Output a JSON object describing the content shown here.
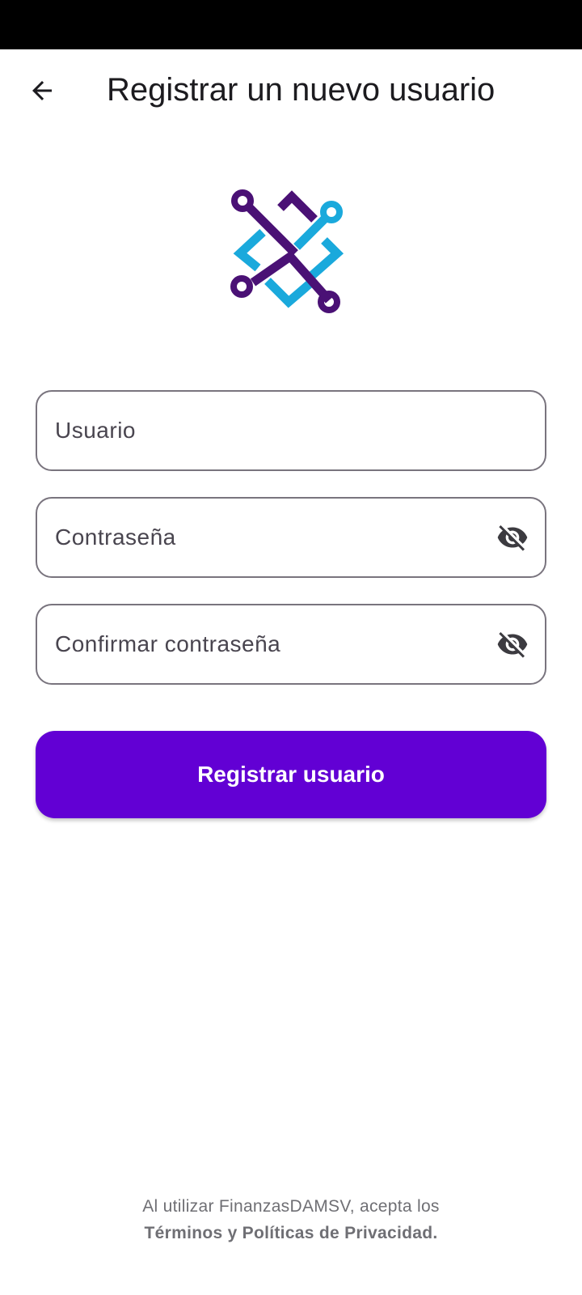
{
  "app_bar": {
    "title": "Registrar un nuevo usuario",
    "back_icon": "arrow-back-icon"
  },
  "logo": {
    "icon": "finanzas-logo-icon",
    "colors": {
      "purple": "#4a1175",
      "cyan": "#1aa9dc"
    }
  },
  "form": {
    "username": {
      "placeholder": "Usuario",
      "value": ""
    },
    "password": {
      "placeholder": "Contraseña",
      "value": "",
      "toggle_icon": "visibility-off-icon"
    },
    "confirm_password": {
      "placeholder": "Confirmar contraseña",
      "value": "",
      "toggle_icon": "visibility-off-icon"
    }
  },
  "submit_button": {
    "label": "Registrar usuario",
    "color": "#6200d4"
  },
  "footer": {
    "text": "Al utilizar FinanzasDAMSV, acepta los",
    "link": "Términos y Políticas de Privacidad."
  }
}
